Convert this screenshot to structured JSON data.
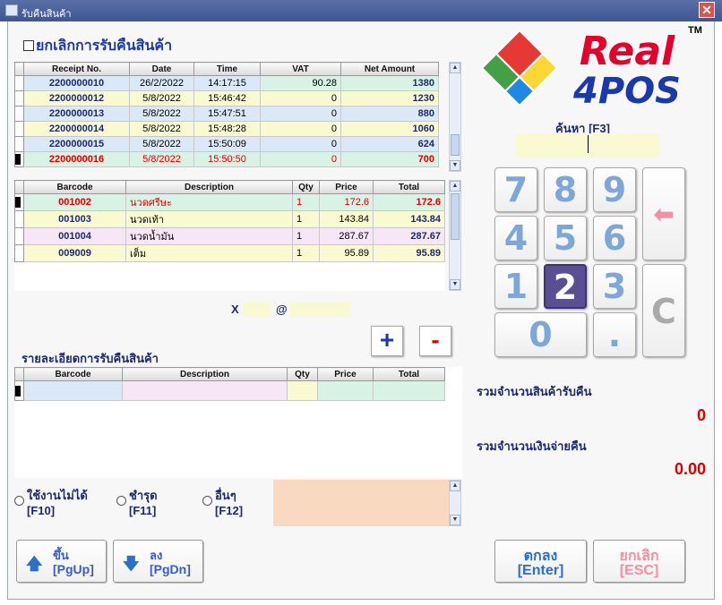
{
  "window": {
    "title": "รับคืนสินค้า",
    "close": "✕"
  },
  "cancel_checkbox": {
    "label": "ยกเลิกการรับคืนสินค้า"
  },
  "receipts": {
    "headers": [
      "Receipt No.",
      "Date",
      "Time",
      "VAT",
      "Net Amount"
    ],
    "rows": [
      {
        "no": "2200000010",
        "date": "26/2/2022",
        "time": "14:17:15",
        "vat": "90.28",
        "net": "1380"
      },
      {
        "no": "2200000012",
        "date": "5/8/2022",
        "time": "15:46:42",
        "vat": "0",
        "net": "1230"
      },
      {
        "no": "2200000013",
        "date": "5/8/2022",
        "time": "15:47:51",
        "vat": "0",
        "net": "880"
      },
      {
        "no": "2200000014",
        "date": "5/8/2022",
        "time": "15:48:28",
        "vat": "0",
        "net": "1060"
      },
      {
        "no": "2200000015",
        "date": "5/8/2022",
        "time": "15:50:09",
        "vat": "0",
        "net": "624"
      },
      {
        "no": "2200000016",
        "date": "5/8/2022",
        "time": "15:50:50",
        "vat": "0",
        "net": "700"
      }
    ]
  },
  "items": {
    "headers": [
      "Barcode",
      "Description",
      "Qty",
      "Price",
      "Total"
    ],
    "rows": [
      {
        "barcode": "001002",
        "desc": "นวดศรีษะ",
        "qty": "1",
        "price": "172.6",
        "total": "172.6"
      },
      {
        "barcode": "001003",
        "desc": "นวดเท้า",
        "qty": "1",
        "price": "143.84",
        "total": "143.84"
      },
      {
        "barcode": "001004",
        "desc": "นวดน้ำมัน",
        "qty": "1",
        "price": "287.67",
        "total": "287.67"
      },
      {
        "barcode": "009009",
        "desc": "เต็ม",
        "qty": "1",
        "price": "95.89",
        "total": "95.89"
      }
    ]
  },
  "qty_entry": {
    "x_label": "X",
    "at_label": "@"
  },
  "buttons": {
    "plus": "+",
    "minus": "-",
    "up_label": "ขึ้น",
    "up_key": "[PgUp]",
    "down_label": "ลง",
    "down_key": "[PgDn]",
    "ok_label": "ตกลง",
    "ok_key": "[Enter]",
    "cancel_label": "ยกเลิก",
    "cancel_key": "[ESC]"
  },
  "return_details": {
    "title": "รายละเอียดการรับคืนสินค้า",
    "headers": [
      "Barcode",
      "Description",
      "Qty",
      "Price",
      "Total"
    ]
  },
  "reasons": [
    {
      "label": "ใช้งานไม่ได้",
      "key": "[F10]"
    },
    {
      "label": "ชำรุด",
      "key": "[F11]"
    },
    {
      "label": "อื่นๆ",
      "key": "[F12]"
    }
  ],
  "logo": {
    "line1": "Real",
    "line2": "4POS",
    "tm": "TM"
  },
  "search": {
    "label": "ค้นหา [F3]"
  },
  "keypad": [
    "7",
    "8",
    "9",
    "4",
    "5",
    "6",
    "1",
    "2",
    "3",
    "0",
    ".",
    "C"
  ],
  "keypad_back": "⬅",
  "totals": {
    "qty_label": "รวมจำนวนสินค้ารับคืน",
    "qty_value": "0",
    "amount_label": "รวมจำนวนเงินจ่ายคืน",
    "amount_value": "0.00"
  },
  "colors": {
    "accent": "#1b2a70",
    "red": "#e00000",
    "keypad_text": "#7ca7d8",
    "active_key": "#5a4f92"
  }
}
